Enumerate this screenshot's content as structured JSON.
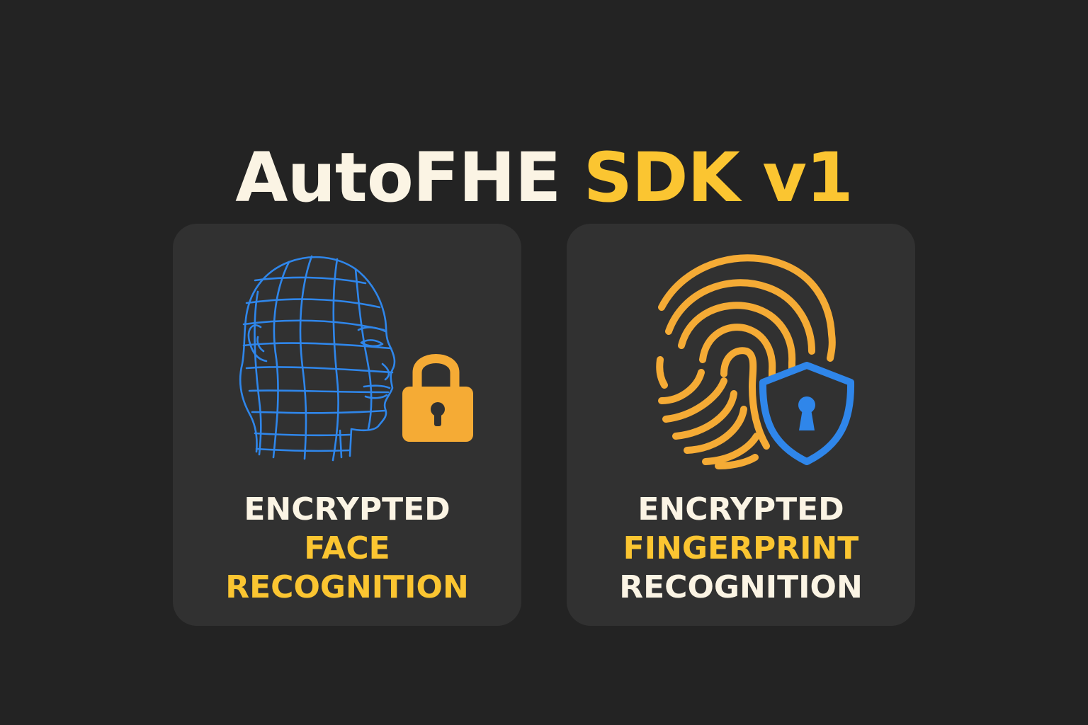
{
  "title": {
    "part1": "AutoFHE",
    "part2": "SDK v1"
  },
  "cards": [
    {
      "caption": [
        "ENCRYPTED",
        "FACE",
        "RECOGNITION"
      ],
      "illustration_icon": "wireframe-face-icon",
      "badge_icon": "padlock-icon"
    },
    {
      "caption": [
        "ENCRYPTED",
        "FINGERPRINT",
        "RECOGNITION"
      ],
      "illustration_icon": "fingerprint-icon",
      "badge_icon": "shield-keyhole-icon"
    }
  ],
  "colors": {
    "background": "#232323",
    "card": "#313131",
    "text_light": "#fbf4e4",
    "accent_yellow": "#fbc531",
    "icon_orange": "#f5ab35",
    "icon_blue": "#2f86ea"
  }
}
